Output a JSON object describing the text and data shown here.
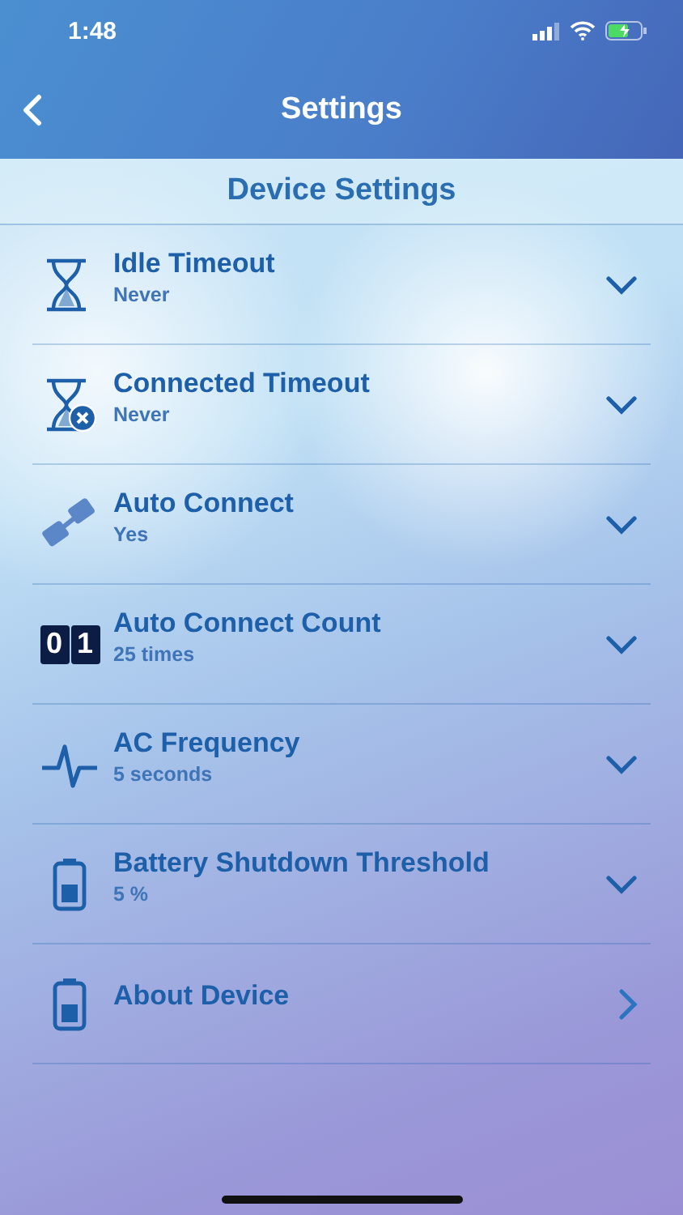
{
  "status_bar": {
    "time": "1:48"
  },
  "nav": {
    "title": "Settings"
  },
  "section": {
    "title": "Device Settings"
  },
  "rows": [
    {
      "title": "Idle Timeout",
      "value": "Never",
      "kind": "expand"
    },
    {
      "title": "Connected Timeout",
      "value": "Never",
      "kind": "expand"
    },
    {
      "title": "Auto Connect",
      "value": "Yes",
      "kind": "expand"
    },
    {
      "title": "Auto Connect Count",
      "value": "25 times",
      "kind": "expand",
      "counter_digits": [
        "0",
        "1"
      ]
    },
    {
      "title": "AC Frequency",
      "value": "5 seconds",
      "kind": "expand"
    },
    {
      "title": "Battery Shutdown Threshold",
      "value": "5 %",
      "kind": "expand"
    },
    {
      "title": "About Device",
      "kind": "link"
    }
  ]
}
